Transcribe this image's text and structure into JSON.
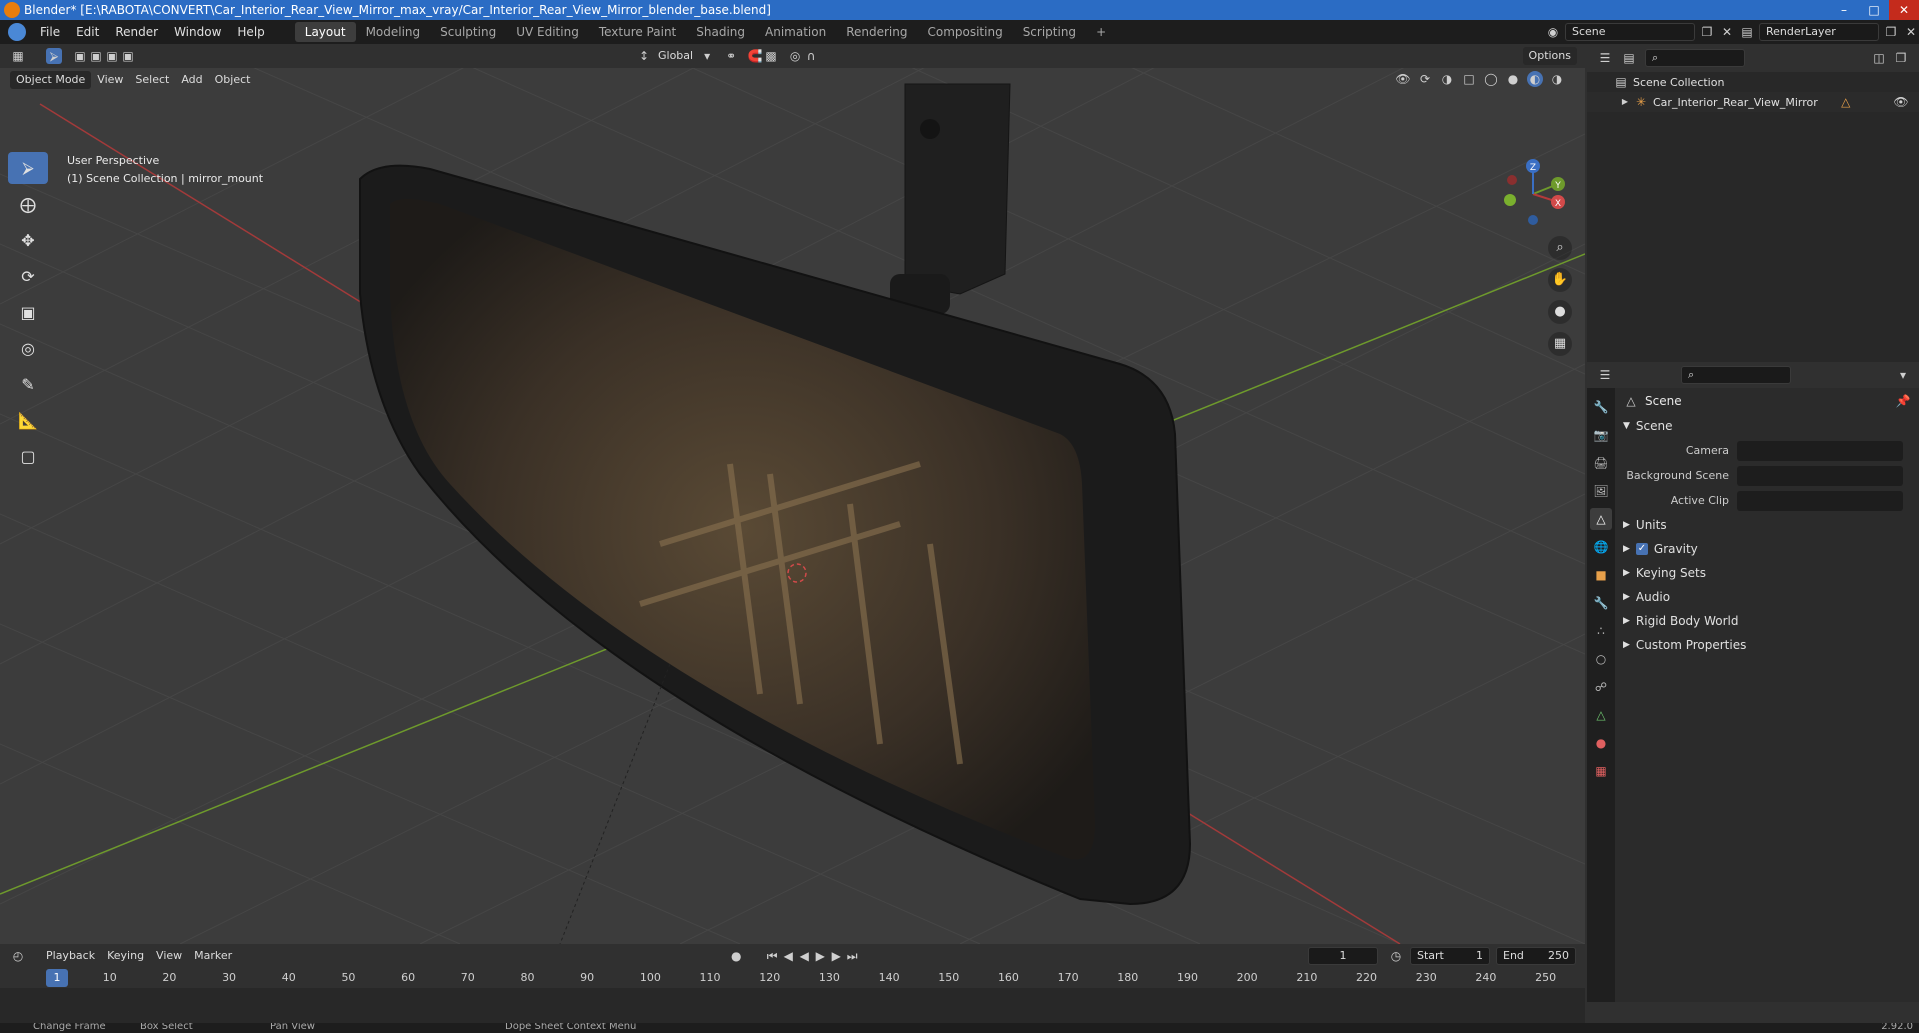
{
  "titlebar": {
    "title": "Blender* [E:\\RABOTA\\CONVERT\\Car_Interior_Rear_View_Mirror_max_vray/Car_Interior_Rear_View_Mirror_blender_base.blend]",
    "minimize": "–",
    "maximize": "□",
    "close": "✕"
  },
  "menubar": {
    "menus": [
      "File",
      "Edit",
      "Render",
      "Window",
      "Help"
    ],
    "workspaces": [
      "Layout",
      "Modeling",
      "Sculpting",
      "UV Editing",
      "Texture Paint",
      "Shading",
      "Animation",
      "Rendering",
      "Compositing",
      "Scripting"
    ],
    "active_workspace": "Layout",
    "add_workspace": "+",
    "scene": "Scene",
    "render_layer": "RenderLayer"
  },
  "viewport_header": {
    "transform_orientation": "Global",
    "options": "Options",
    "mode": "Object Mode",
    "menus": [
      "View",
      "Select",
      "Add",
      "Object"
    ]
  },
  "viewport": {
    "perspective": "User Perspective",
    "collection_info": "(1) Scene Collection | mirror_mount",
    "gizmo_labels": {
      "x": "X",
      "y": "Y",
      "z": "Z"
    },
    "colors": {
      "bg": "#3c3c3c",
      "grid": "#4a4a4a",
      "x_axis": "#b33a3a",
      "y_axis": "#6b9a2a",
      "accent": "#4772b3"
    }
  },
  "outliner": {
    "scene_collection": "Scene Collection",
    "items": [
      {
        "label": "Car_Interior_Rear_View_Mirror"
      }
    ]
  },
  "properties": {
    "context": "Scene",
    "panel_title": "Scene",
    "fields": [
      {
        "label": "Camera",
        "value": ""
      },
      {
        "label": "Background Scene",
        "value": ""
      },
      {
        "label": "Active Clip",
        "value": ""
      }
    ],
    "subpanels": [
      "Units",
      "Gravity",
      "Keying Sets",
      "Audio",
      "Rigid Body World",
      "Custom Properties"
    ],
    "gravity_checked": true
  },
  "timeline": {
    "menus": [
      "Playback",
      "Keying",
      "View",
      "Marker"
    ],
    "current_frame": "1",
    "start_label": "Start",
    "start_value": "1",
    "end_label": "End",
    "end_value": "250",
    "ticks": [
      "1",
      "10",
      "20",
      "30",
      "40",
      "50",
      "60",
      "70",
      "80",
      "90",
      "100",
      "110",
      "120",
      "130",
      "140",
      "150",
      "160",
      "170",
      "180",
      "190",
      "200",
      "210",
      "220",
      "230",
      "240",
      "250"
    ]
  },
  "statusbar": {
    "items": [
      "Change Frame",
      "Box Select",
      "Pan View",
      "Dope Sheet Context Menu"
    ],
    "version": "2.92.0"
  }
}
